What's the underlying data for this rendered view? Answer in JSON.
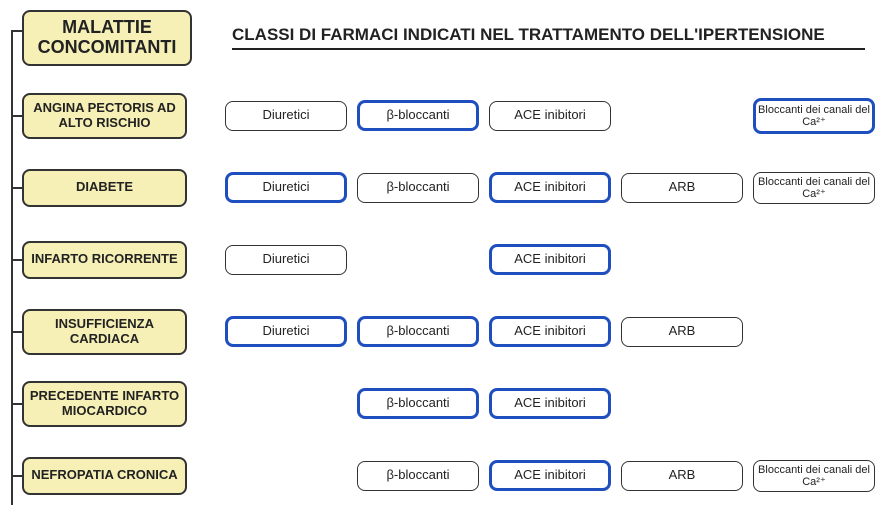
{
  "header": {
    "box": "MALATTIE\nCONCOMITANTI",
    "title": "CLASSI DI FARMACI INDICATI NEL TRATTAMENTO DELL'IPERTENSIONE"
  },
  "drug_labels": {
    "diuretici": "Diuretici",
    "beta_bloccanti": "β-bloccanti",
    "ace_inibitori": "ACE inibitori",
    "arb": "ARB",
    "ca_bloccanti": "Bloccanti dei canali del Ca²⁺"
  },
  "rows": [
    {
      "condition": "ANGINA PECTORIS\nAD ALTO RISCHIO",
      "cells": [
        {
          "key": "diuretici",
          "style": "thin"
        },
        {
          "key": "beta_bloccanti",
          "style": "thick"
        },
        {
          "key": "ace_inibitori",
          "style": "thin"
        },
        {
          "key": null
        },
        {
          "key": "ca_bloccanti",
          "style": "thick",
          "small": true
        }
      ]
    },
    {
      "condition": "DIABETE",
      "cells": [
        {
          "key": "diuretici",
          "style": "thick"
        },
        {
          "key": "beta_bloccanti",
          "style": "thin"
        },
        {
          "key": "ace_inibitori",
          "style": "thick"
        },
        {
          "key": "arb",
          "style": "thin"
        },
        {
          "key": "ca_bloccanti",
          "style": "thin",
          "small": true
        }
      ]
    },
    {
      "condition": "INFARTO\nRICORRENTE",
      "cells": [
        {
          "key": "diuretici",
          "style": "thin"
        },
        {
          "key": null
        },
        {
          "key": "ace_inibitori",
          "style": "thick"
        },
        {
          "key": null
        },
        {
          "key": null
        }
      ]
    },
    {
      "condition": "INSUFFICIENZA\nCARDIACA",
      "cells": [
        {
          "key": "diuretici",
          "style": "thick"
        },
        {
          "key": "beta_bloccanti",
          "style": "thick"
        },
        {
          "key": "ace_inibitori",
          "style": "thick"
        },
        {
          "key": "arb",
          "style": "thin"
        },
        {
          "key": null
        }
      ]
    },
    {
      "condition": "PRECEDENTE\nINFARTO MIOCARDICO",
      "cells": [
        {
          "key": null
        },
        {
          "key": "beta_bloccanti",
          "style": "thick"
        },
        {
          "key": "ace_inibitori",
          "style": "thick"
        },
        {
          "key": null
        },
        {
          "key": null
        }
      ]
    },
    {
      "condition": "NEFROPATIA\nCRONICA",
      "cells": [
        {
          "key": null
        },
        {
          "key": "beta_bloccanti",
          "style": "thin"
        },
        {
          "key": "ace_inibitori",
          "style": "thick"
        },
        {
          "key": "arb",
          "style": "thin"
        },
        {
          "key": "ca_bloccanti",
          "style": "thin",
          "small": true
        }
      ]
    }
  ]
}
